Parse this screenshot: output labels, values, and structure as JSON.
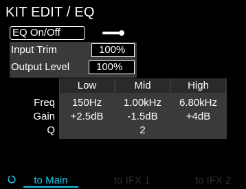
{
  "header": {
    "title": "KIT EDIT / EQ"
  },
  "settings": {
    "eq_on_off_label": "EQ On/Off",
    "eq_on": true,
    "input_trim_label": "Input Trim",
    "input_trim_value": "100%",
    "output_level_label": "Output Level",
    "output_level_value": "100%"
  },
  "eq_table": {
    "columns": [
      "Low",
      "Mid",
      "High"
    ],
    "rows": [
      {
        "name": "Freq",
        "values": [
          "150Hz",
          "1.00kHz",
          "6.80kHz"
        ]
      },
      {
        "name": "Gain",
        "values": [
          "+2.5dB",
          "-1.5dB",
          "+4dB"
        ]
      },
      {
        "name": "Q",
        "values": [
          "",
          "2",
          ""
        ]
      }
    ]
  },
  "footer": {
    "undo_icon": "undo-icon",
    "tabs": [
      "to Main",
      "to IFX 1",
      "to IFX 2"
    ]
  },
  "colors": {
    "accent": "#1ec8e6",
    "panel": "#3a3a3a",
    "dim_text": "#2f2f2f"
  }
}
